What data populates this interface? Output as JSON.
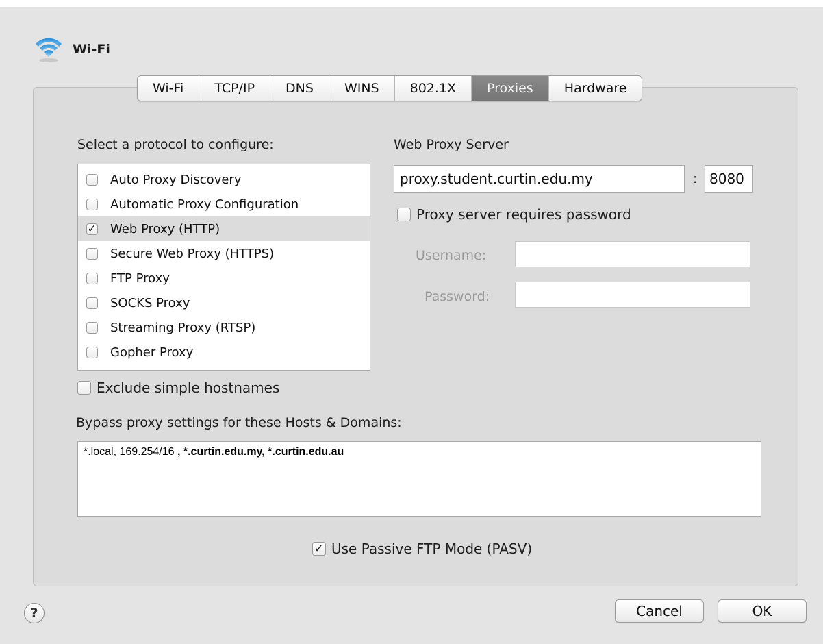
{
  "window": {
    "title": "Wi-Fi",
    "icon": "wifi-icon"
  },
  "tabs": [
    {
      "label": "Wi-Fi",
      "active": false
    },
    {
      "label": "TCP/IP",
      "active": false
    },
    {
      "label": "DNS",
      "active": false
    },
    {
      "label": "WINS",
      "active": false
    },
    {
      "label": "802.1X",
      "active": false
    },
    {
      "label": "Proxies",
      "active": true
    },
    {
      "label": "Hardware",
      "active": false
    }
  ],
  "protocols": {
    "heading": "Select a protocol to configure:",
    "items": [
      {
        "label": "Auto Proxy Discovery",
        "checked": false
      },
      {
        "label": "Automatic Proxy Configuration",
        "checked": false
      },
      {
        "label": "Web Proxy (HTTP)",
        "checked": true
      },
      {
        "label": "Secure Web Proxy (HTTPS)",
        "checked": false
      },
      {
        "label": "FTP Proxy",
        "checked": false
      },
      {
        "label": "SOCKS Proxy",
        "checked": false
      },
      {
        "label": "Streaming Proxy (RTSP)",
        "checked": false
      },
      {
        "label": "Gopher Proxy",
        "checked": false
      }
    ],
    "selected_index": 2
  },
  "proxy_server": {
    "heading": "Web Proxy Server",
    "host": "proxy.student.curtin.edu.my",
    "separator": ":",
    "port": "8080",
    "requires_password_label": "Proxy server requires password",
    "requires_password": false,
    "username_label": "Username:",
    "username": "",
    "password_label": "Password:",
    "password": ""
  },
  "exclude_simple_hostnames": {
    "label": "Exclude simple hostnames",
    "checked": false
  },
  "bypass": {
    "label": "Bypass proxy settings for these Hosts & Domains:",
    "value_plain": "*.local, 169.254/16",
    "value_bold": " , *.curtin.edu.my, *.curtin.edu.au"
  },
  "passive_ftp": {
    "label": "Use Passive FTP Mode (PASV)",
    "checked": true
  },
  "buttons": {
    "help": "?",
    "cancel": "Cancel",
    "ok": "OK"
  }
}
